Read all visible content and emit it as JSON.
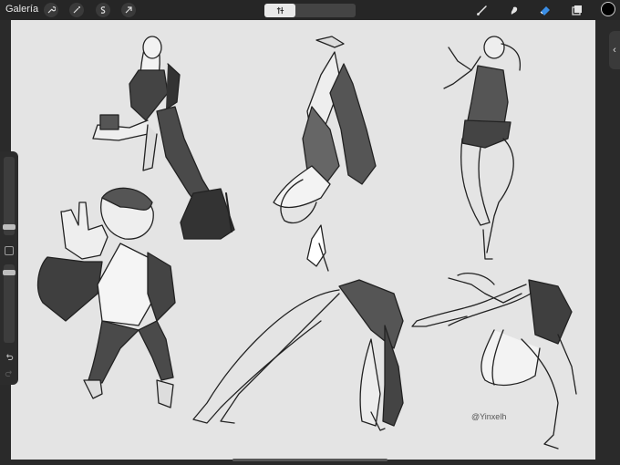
{
  "toolbar": {
    "gallery_label": "Galería",
    "tools": [
      "wrench-icon",
      "magic-wand-icon",
      "selection-icon",
      "transform-arrow-icon"
    ],
    "right_tools": [
      "brush-icon",
      "smudge-icon",
      "eraser-icon",
      "layers-icon"
    ],
    "current_color": "#000000",
    "accent_color": "#3a8ee6"
  },
  "center_control": {
    "icon": "quickmenu-icon"
  },
  "canvas": {
    "background": "#e4e4e4",
    "watermark": "@Yinxelh"
  },
  "sidebar": {
    "brush_size_level": 0.45,
    "opacity_level": 0.3
  }
}
